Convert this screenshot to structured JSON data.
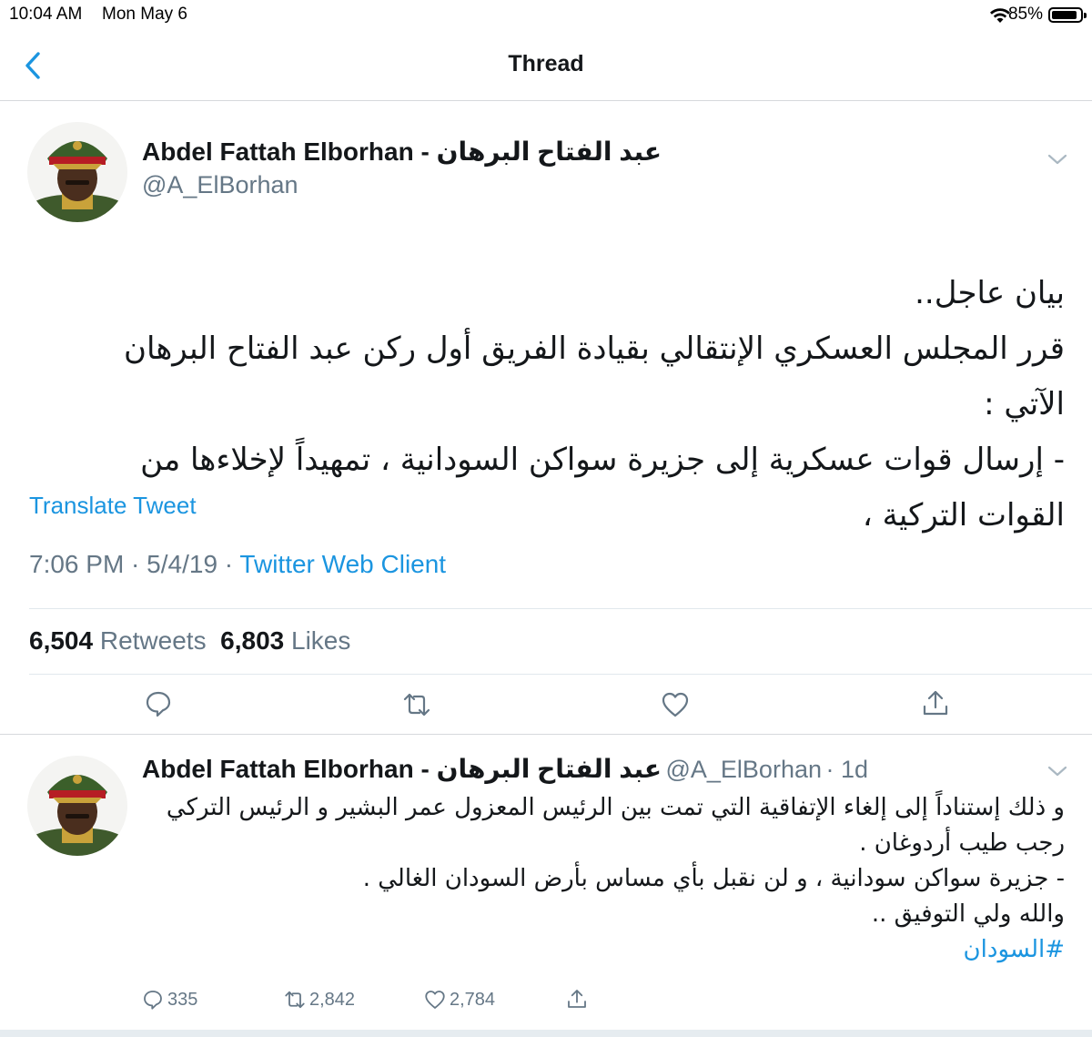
{
  "status_bar": {
    "time": "10:04 AM",
    "date": "Mon May 6",
    "battery": "85%",
    "battery_level": 0.85
  },
  "nav": {
    "title": "Thread",
    "back_icon": "chevron-left-icon"
  },
  "main_tweet": {
    "author_name": "Abdel Fattah Elborhan - عبد الفتاح البرهان",
    "author_handle": "@A_ElBorhan",
    "text_lines": [
      "بيان عاجل..",
      "قرر المجلس العسكري الإنتقالي بقيادة الفريق أول ركن عبد الفتاح البرهان الآتي :",
      "- إرسال قوات عسكرية إلى جزيرة سواكن السودانية ، تمهيداً لإخلاءها من القوات التركية ،"
    ],
    "translate_label": "Translate Tweet",
    "time": "7:06 PM",
    "date": "5/4/19",
    "source": "Twitter Web Client",
    "retweets_count": "6,504",
    "retweets_label": "Retweets",
    "likes_count": "6,803",
    "likes_label": "Likes"
  },
  "reply_tweet": {
    "author_name": "Abdel Fattah Elborhan - عبد الفتاح البرهان",
    "author_handle": "@A_ElBorhan",
    "age": "· 1d",
    "text_lines": [
      "و ذلك إستناداً إلى إلغاء الإتفاقية التي تمت بين الرئيس المعزول عمر البشير و الرئيس التركي رجب طيب أردوغان .",
      "- جزيرة سواكن سودانية ، و لن نقبل بأي مساس بأرض السودان الغالي .",
      "والله ولي التوفيق .."
    ],
    "hashtag": "#السودان",
    "replies": "335",
    "retweets": "2,842",
    "likes": "2,784"
  },
  "colors": {
    "accent": "#1b95e0",
    "text": "#14171a",
    "secondary": "#657786",
    "divider": "#e1e8ed"
  }
}
